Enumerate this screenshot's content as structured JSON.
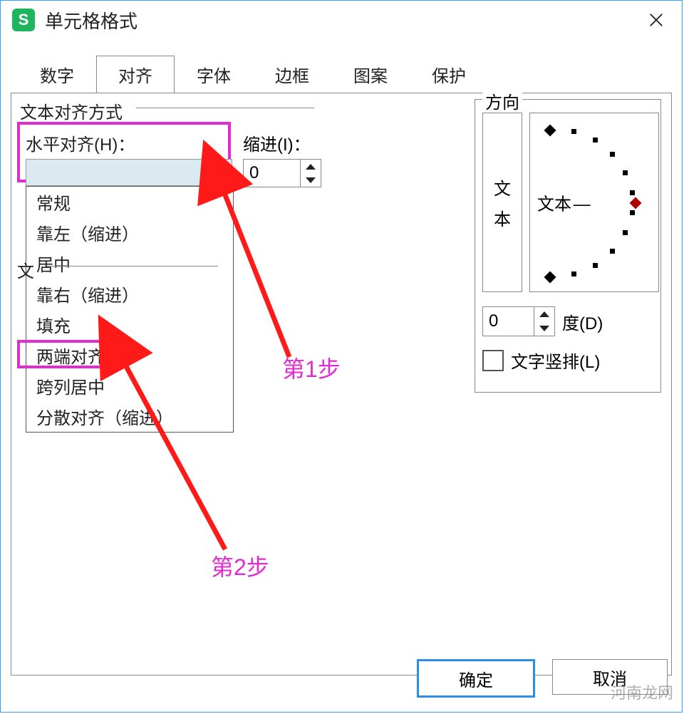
{
  "window": {
    "title": "单元格格式",
    "app_icon_letter": "S"
  },
  "tabs": {
    "items": [
      "数字",
      "对齐",
      "字体",
      "边框",
      "图案",
      "保护"
    ],
    "active_index": 1
  },
  "align": {
    "group_label": "文本对齐方式",
    "horizontal_label": "水平对齐(H)：",
    "horizontal_value": "",
    "indent_label": "缩进(I)：",
    "indent_value": "0",
    "secondary_label": "文",
    "options": [
      "常规",
      "靠左（缩进）",
      "居中",
      "靠右（缩进）",
      "填充",
      "两端对齐",
      "跨列居中",
      "分散对齐（缩进）"
    ]
  },
  "direction": {
    "group_label": "方向",
    "vertical_chars": [
      "文",
      "本"
    ],
    "arc_text": "文本",
    "degree_value": "0",
    "degree_label": "度(D)",
    "vertical_text_label": "文字竖排(L)"
  },
  "buttons": {
    "ok": "确定",
    "cancel": "取消"
  },
  "annotations": {
    "step1": "第1步",
    "step2": "第2步"
  },
  "watermark": "河南龙网"
}
